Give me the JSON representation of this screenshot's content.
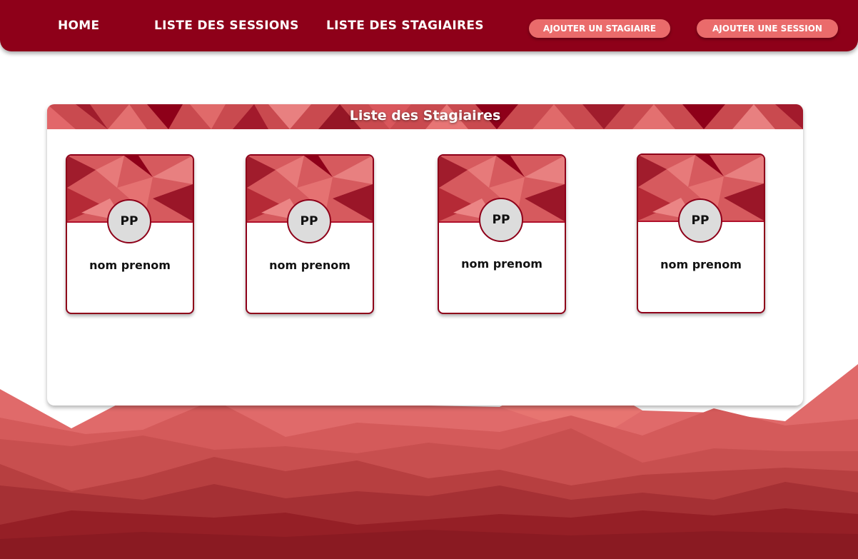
{
  "nav": {
    "links": [
      {
        "label": "HOME"
      },
      {
        "label": "LISTE DES SESSIONS"
      },
      {
        "label": "LISTE DES STAGIAIRES"
      }
    ],
    "buttons": [
      {
        "label": "AJOUTER UN STAGIAIRE"
      },
      {
        "label": "AJOUTER UNE SESSION"
      }
    ]
  },
  "panel": {
    "title": "Liste des Stagiaires"
  },
  "cards": [
    {
      "avatar": "PP",
      "name": "nom prenom"
    },
    {
      "avatar": "PP",
      "name": "nom prenom"
    },
    {
      "avatar": "PP",
      "name": "nom prenom"
    },
    {
      "avatar": "PP",
      "name": "nom prenom"
    }
  ],
  "colors": {
    "primary": "#8e0019",
    "button": "#ea6b6b",
    "avatar_bg": "#dcdcdc"
  }
}
